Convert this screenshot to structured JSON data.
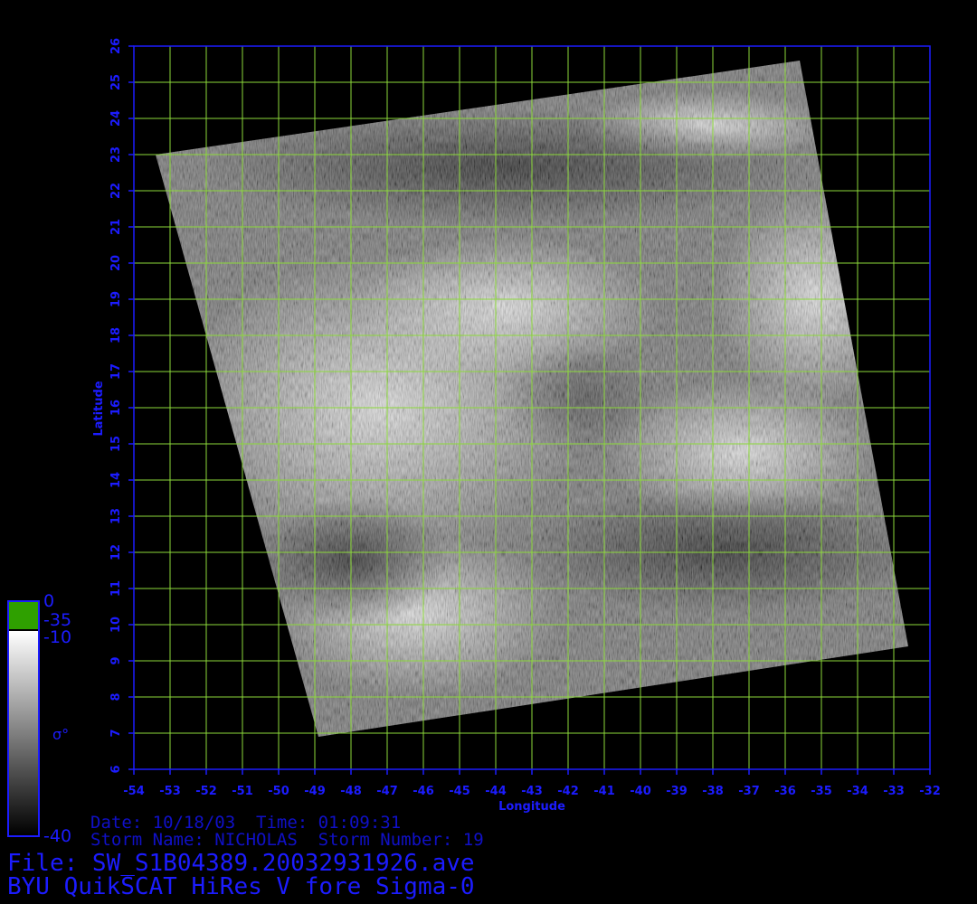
{
  "map": {
    "x_axis": {
      "title": "Longitude",
      "min": -54,
      "max": -32,
      "step": 1,
      "tick_labels": [
        "-54",
        "-53",
        "-52",
        "-51",
        "-50",
        "-49",
        "-48",
        "-47",
        "-46",
        "-45",
        "-44",
        "-43",
        "-42",
        "-41",
        "-40",
        "-39",
        "-38",
        "-37",
        "-36",
        "-35",
        "-34",
        "-33",
        "-32"
      ]
    },
    "y_axis": {
      "title": "Latitude",
      "min": 6,
      "max": 26,
      "step": 1,
      "tick_labels": [
        "6",
        "7",
        "8",
        "9",
        "10",
        "11",
        "12",
        "13",
        "14",
        "15",
        "16",
        "17",
        "18",
        "19",
        "20",
        "21",
        "22",
        "23",
        "24",
        "25",
        "26"
      ]
    },
    "grid_color": "#8cd93a",
    "frame_color": "#1c1cff",
    "swath_corners_lonlat": [
      [
        -53.4,
        23.0
      ],
      [
        -35.6,
        25.6
      ],
      [
        -32.6,
        9.4
      ],
      [
        -48.9,
        6.9
      ]
    ]
  },
  "colorbar": {
    "labels": [
      "0",
      "-35",
      "-10",
      "σ°",
      "-40"
    ],
    "green": "#2fa000",
    "top_value": "0",
    "mid_value_a": "-35",
    "mid_value_b": "-10",
    "symbol": "σ°",
    "bottom_value": "-40"
  },
  "info": {
    "date_line": "Date: 10/18/03  Time: 01:09:31",
    "storm_line": "Storm Name: NICHOLAS  Storm Number: 19",
    "file_line": "File: SW_S1B04389.20032931926.ave",
    "product_line": "BYU QuikSCAT HiRes V fore Sigma-0"
  }
}
